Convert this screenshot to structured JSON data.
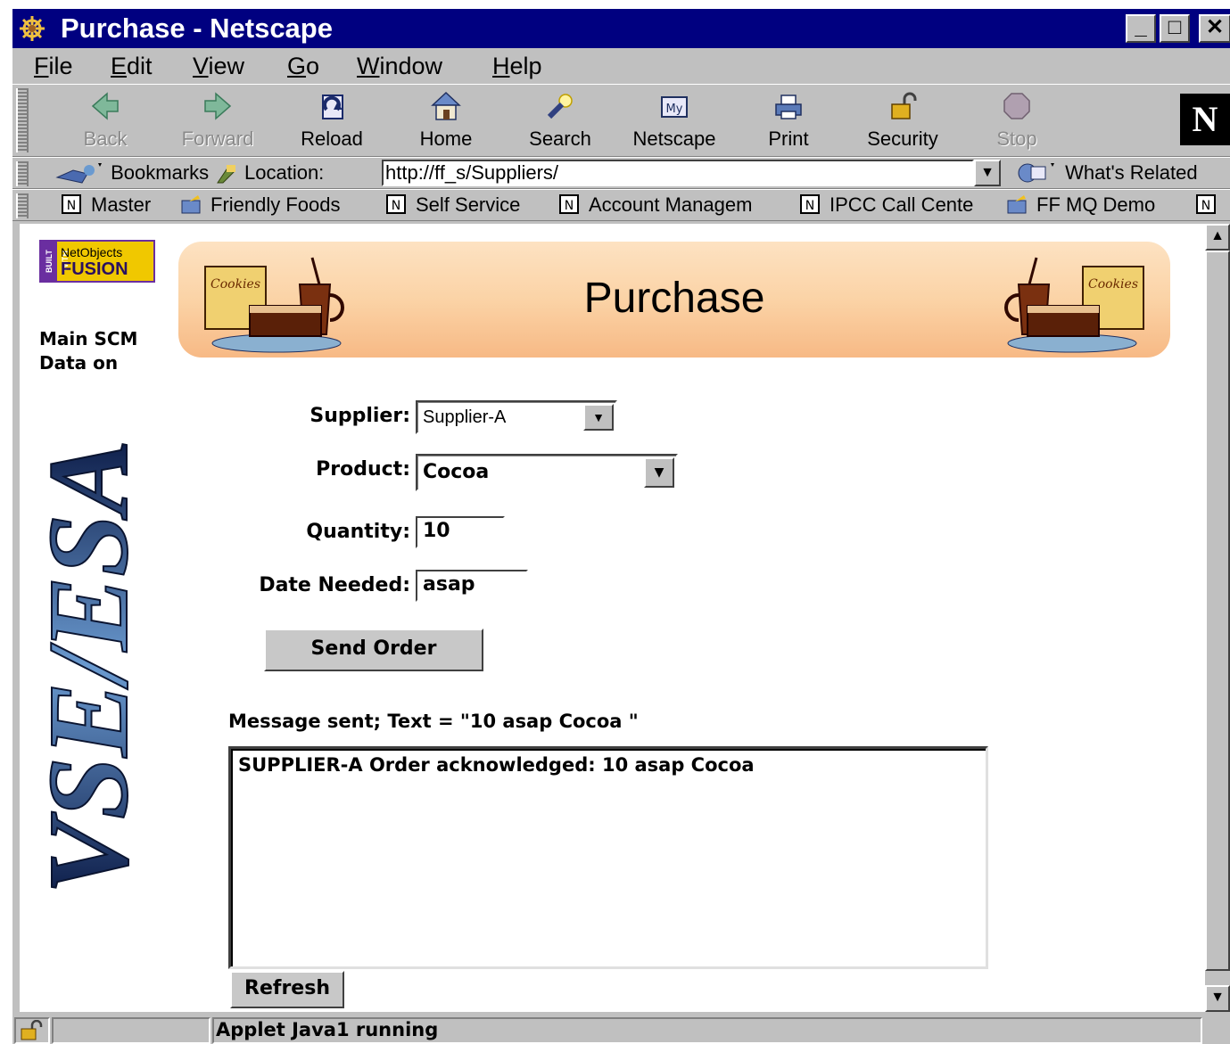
{
  "window": {
    "title": "Purchase - Netscape",
    "controls": {
      "minimize": "_",
      "maximize": "□",
      "close": "✕"
    }
  },
  "menu": [
    {
      "key": "F",
      "rest": "ile"
    },
    {
      "key": "E",
      "rest": "dit"
    },
    {
      "key": "V",
      "rest": "iew"
    },
    {
      "key": "G",
      "rest": "o"
    },
    {
      "key": "W",
      "rest": "indow"
    },
    {
      "key": "H",
      "rest": "elp"
    }
  ],
  "toolbar": {
    "back": "Back",
    "forward": "Forward",
    "reload": "Reload",
    "home": "Home",
    "search": "Search",
    "netscape": "Netscape",
    "print": "Print",
    "security": "Security",
    "stop": "Stop",
    "logo": "N"
  },
  "location": {
    "bookmarks": "Bookmarks",
    "label": "Location:",
    "url": "http://ff_s/Suppliers/",
    "related": "What's Related"
  },
  "personal_toolbar": [
    {
      "label": "Master",
      "icon": "page-icon"
    },
    {
      "label": "Friendly Foods",
      "icon": "folder-icon"
    },
    {
      "label": "Self Service",
      "icon": "page-icon"
    },
    {
      "label": "Account Managem",
      "icon": "page-icon"
    },
    {
      "label": "IPCC Call Cente",
      "icon": "page-icon"
    },
    {
      "label": "FF MQ Demo",
      "icon": "folder-icon"
    }
  ],
  "page": {
    "badge_line1": "NetObjects",
    "badge_line2": "FUSION",
    "badge_side": "BUILT WITH",
    "side_line1": "Main SCM",
    "side_line2": "Data on",
    "banner_title": "Purchase",
    "logo_text": "VSE/ESA"
  },
  "form": {
    "supplier_label": "Supplier:",
    "supplier_value": "Supplier-A",
    "product_label": "Product:",
    "product_value": "Cocoa",
    "quantity_label": "Quantity:",
    "quantity_value": "10",
    "date_label": "Date Needed:",
    "date_value": "asap",
    "send_button": "Send Order",
    "message": "Message sent; Text = \"10 asap Cocoa \"",
    "response": "SUPPLIER-A Order acknowledged: 10 asap Cocoa",
    "refresh_button": "Refresh"
  },
  "status": {
    "text": "Applet Java1 running"
  },
  "colors": {
    "titlebar": "#000080",
    "chrome": "#c0c0c0",
    "banner_top": "#fde2c2",
    "banner_bottom": "#f7b985",
    "logo_blue": "#1e3a78"
  }
}
